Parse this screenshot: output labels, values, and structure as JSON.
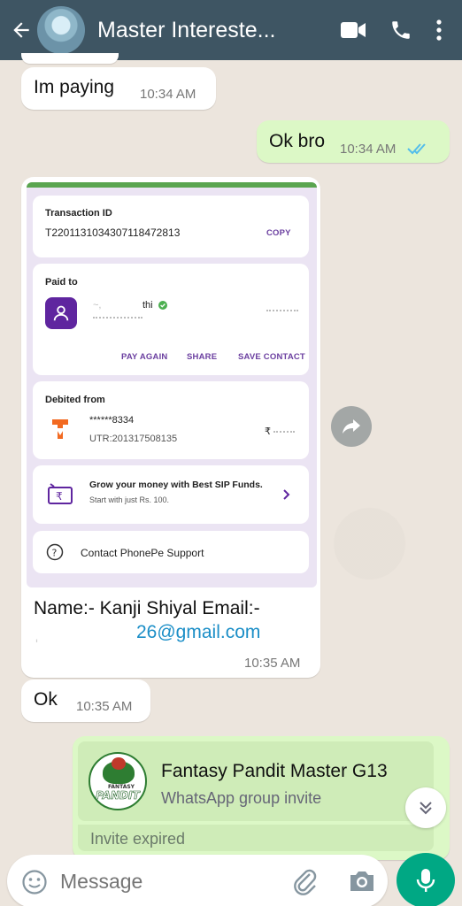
{
  "header": {
    "title": "Master Intereste..."
  },
  "messages": [
    {
      "text": "Im paying",
      "time": "10:34 AM"
    },
    {
      "text": "Ok bro",
      "time": "10:34 AM"
    },
    {
      "text": "Ok",
      "time": "10:35 AM"
    }
  ],
  "payment_card": {
    "transaction_label": "Transaction ID",
    "transaction_id": "T2201131034307118472813",
    "copy_label": "COPY",
    "paid_to_label": "Paid to",
    "payee_name": "thi",
    "pay_again": "PAY AGAIN",
    "share": "SHARE",
    "save_contact": "SAVE CONTACT",
    "debited_label": "Debited from",
    "account": "******8334",
    "utr": "UTR:201317508135",
    "amount_symbol": "₹",
    "sip_title": "Grow your money with Best SIP Funds.",
    "sip_sub": "Start with just Rs. 100.",
    "support": "Contact PhonePe Support"
  },
  "payment_caption": {
    "line1": "Name:- Kanji Shiyal Email:-",
    "line2": "26@gmail.com",
    "time": "10:35 AM"
  },
  "group_invite": {
    "logo_text": "PANDIT",
    "logo_sub": "FANTASY",
    "title": "Fantasy Pandit Master G13",
    "subtitle": "WhatsApp group invite",
    "status": "Invite expired"
  },
  "composer": {
    "placeholder": "Message"
  },
  "colors": {
    "header": "#3e5563",
    "outgoing": "#dcf8c6",
    "accent": "#00a884",
    "read_ticks": "#53bdeb",
    "phonepe": "#5f259f"
  }
}
